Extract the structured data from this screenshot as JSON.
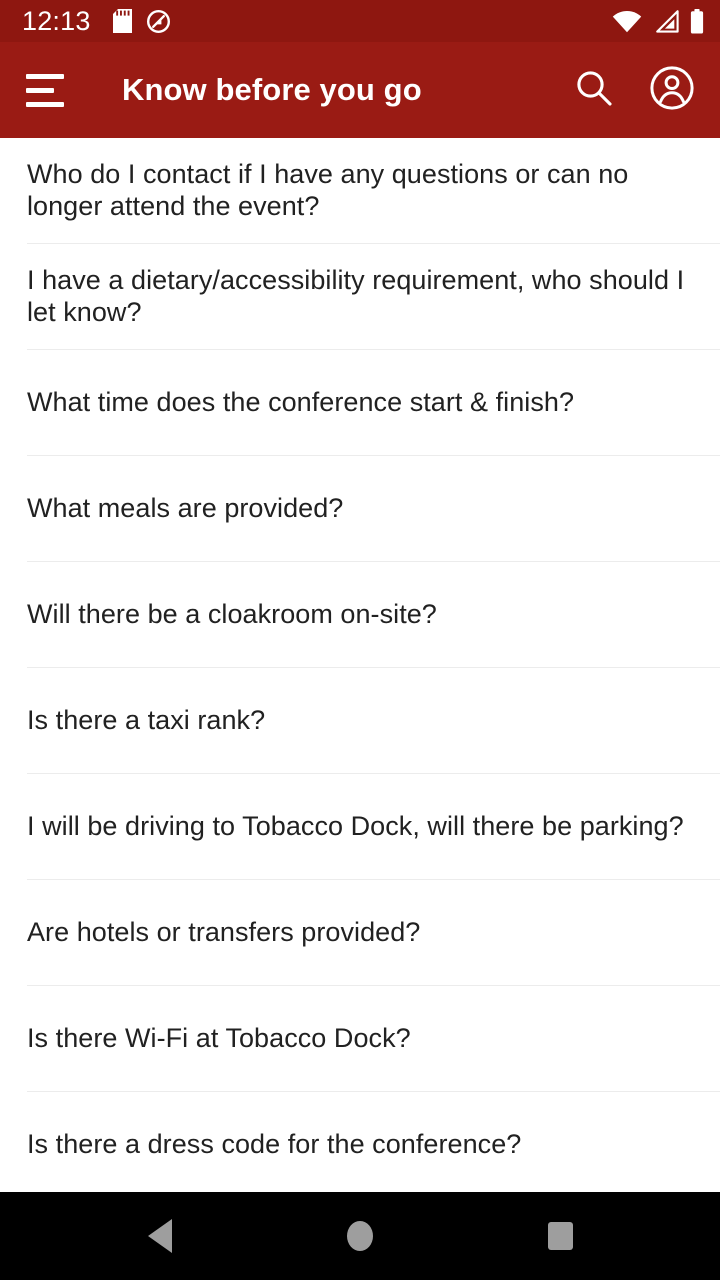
{
  "status_bar": {
    "time": "12:13",
    "left_icons": [
      "sd-card-icon",
      "do-not-disturb-icon"
    ],
    "right_icons": [
      "wifi-icon",
      "cellular-signal-icon",
      "battery-icon"
    ],
    "background_color": "#8E1710"
  },
  "app_bar": {
    "title": "Know before you go",
    "menu_icon": "hamburger-menu-icon",
    "search_icon": "search-icon",
    "account_icon": "account-circle-icon",
    "background_color": "#9A1B14",
    "text_color": "#FFFFFF"
  },
  "list": {
    "divider_color": "#ECECEC",
    "text_color": "#212121",
    "items": [
      {
        "label": "Who do I contact if I have any questions or can no longer attend the event?"
      },
      {
        "label": "I have a dietary/accessibility requirement, who should I let know?"
      },
      {
        "label": "What time does the conference start & finish?"
      },
      {
        "label": "What meals are provided?"
      },
      {
        "label": "Will there be a cloakroom on-site?"
      },
      {
        "label": "Is there a taxi rank?"
      },
      {
        "label": "I will be driving to Tobacco Dock, will there be parking?"
      },
      {
        "label": "Are hotels or transfers provided?"
      },
      {
        "label": "Is there Wi-Fi at Tobacco Dock?"
      },
      {
        "label": "Is there a dress code for the conference?"
      }
    ]
  },
  "nav_bar": {
    "background_color": "#000000",
    "icon_color": "#9E9E9E",
    "buttons": [
      {
        "name": "back-button",
        "icon": "back-triangle-icon"
      },
      {
        "name": "home-button",
        "icon": "home-circle-icon"
      },
      {
        "name": "recents-button",
        "icon": "recents-square-icon"
      }
    ]
  }
}
